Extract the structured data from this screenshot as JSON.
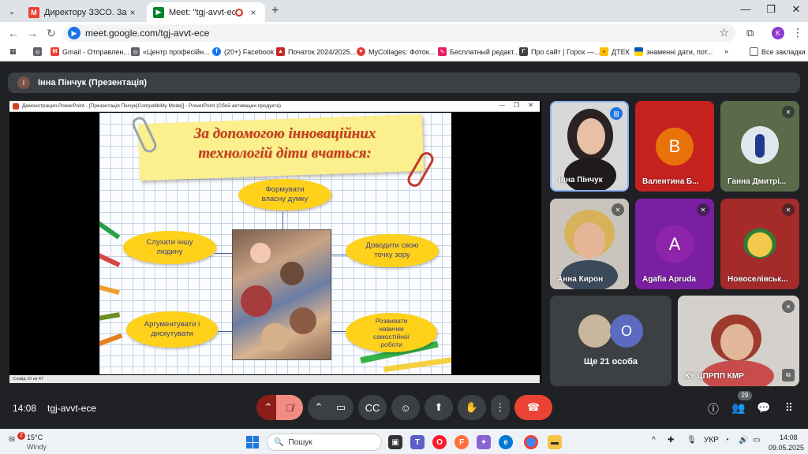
{
  "browser": {
    "tabs": [
      {
        "title": "Директору ЗЗСО. Запрошення",
        "icon": "gmail-icon"
      },
      {
        "title": "Meet: \"tgj-avvt-ece\"",
        "icon": "meet-icon",
        "recording": true
      }
    ],
    "url": "meet.google.com/tgj-avvt-ece",
    "profile_initial": "K",
    "bookmarks": [
      "Gmail - Отправлен...",
      "«Центр професійн...",
      "(20+) Facebook",
      "Початок 2024/2025...",
      "MyCollages: Фоток...",
      "Бесплатный редакт...",
      "Про сайт | Горох —...",
      "ДТЕК",
      "знаменні дати, пот..."
    ],
    "all_bookmarks": "Все закладки"
  },
  "meet": {
    "presenter_initial": "І",
    "presenter_label": "Інна Пінчук (Презентація)",
    "ppt_title": "Демонстрация PowerPoint - [Презентація Пінчук[Compatibility Mode]] - PowerPoint (Сбой активации продукта)",
    "ppt_status": "Слайд 10 из 47",
    "slide": {
      "title_line1": "За допомогою інноваційних",
      "title_line2": "технологій діти вчаться:",
      "ovals": [
        "Формувати власну думку",
        "Слухати іншу людину",
        "Доводити свою точку зору",
        "Аргументувати і дискутувати",
        "Розвивати навички самостійної роботи"
      ]
    },
    "participants": [
      {
        "name": "Інна Пінчук",
        "speaking": true
      },
      {
        "name": "Валентина Б...",
        "initial": "В",
        "color": "#e8710a"
      },
      {
        "name": "Ганна Дмитрі..."
      },
      {
        "name": "Анна Кирон"
      },
      {
        "name": "Agafia Apruda",
        "initial": "A",
        "color": "#8e24aa"
      },
      {
        "name": "Новоселівськ..."
      },
      {
        "name": "Ще 21 особа",
        "initial": "О"
      },
      {
        "name": "КУ ЦПРПП КМР"
      }
    ],
    "time": "14:08",
    "meeting_code": "tgj-avvt-ece",
    "people_count": "29"
  },
  "taskbar": {
    "weather_badge": "2",
    "temperature": "15°C",
    "weather": "Windy",
    "search_placeholder": "Пошук",
    "language": "УКР",
    "clock_time": "14:08",
    "clock_date": "09.05.2025"
  }
}
